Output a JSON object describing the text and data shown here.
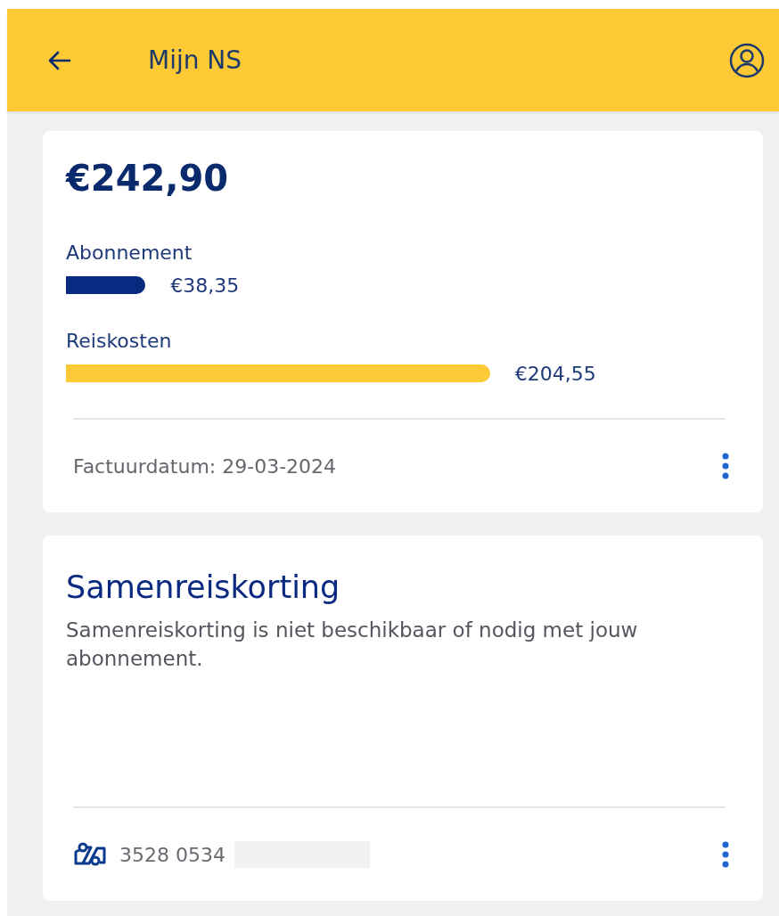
{
  "header": {
    "title": "Mijn NS"
  },
  "invoice": {
    "total": "€242,90",
    "costs": [
      {
        "label": "Abonnement",
        "amount": "€38,35",
        "color": "#0a2a82"
      },
      {
        "label": "Reiskosten",
        "amount": "€204,55",
        "color": "#fcc937"
      }
    ],
    "date": "Factuurdatum: 29-03-2024"
  },
  "discount": {
    "title": "Samenreiskorting",
    "text": "Samenreiskorting is niet beschikbaar of nodig met jouw abonnement.",
    "card_number": "3528 0534"
  }
}
